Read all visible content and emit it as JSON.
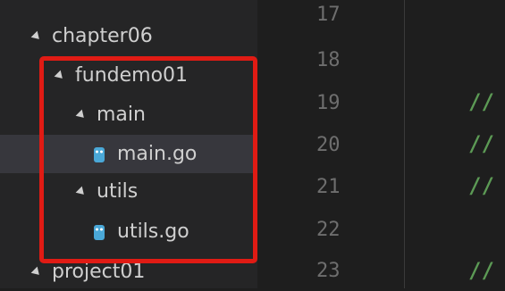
{
  "explorer": {
    "items": [
      {
        "label": "chapter06",
        "type": "folder",
        "expanded": true
      },
      {
        "label": "fundemo01",
        "type": "folder",
        "expanded": true
      },
      {
        "label": "main",
        "type": "folder",
        "expanded": true
      },
      {
        "label": "main.go",
        "type": "file",
        "icon": "go-file-icon",
        "selected": true
      },
      {
        "label": "utils",
        "type": "folder",
        "expanded": true
      },
      {
        "label": "utils.go",
        "type": "file",
        "icon": "go-file-icon"
      },
      {
        "label": "project01",
        "type": "folder",
        "expanded": true
      }
    ]
  },
  "editor": {
    "line_numbers": [
      "17",
      "18",
      "19",
      "20",
      "21",
      "22",
      "23"
    ],
    "code_lines": [
      "//",
      "//",
      "//",
      "//"
    ]
  },
  "colors": {
    "highlight": "#e01b14",
    "selection": "#37373d",
    "comment": "#5c9a55",
    "go_icon": "#4aa8d8"
  }
}
